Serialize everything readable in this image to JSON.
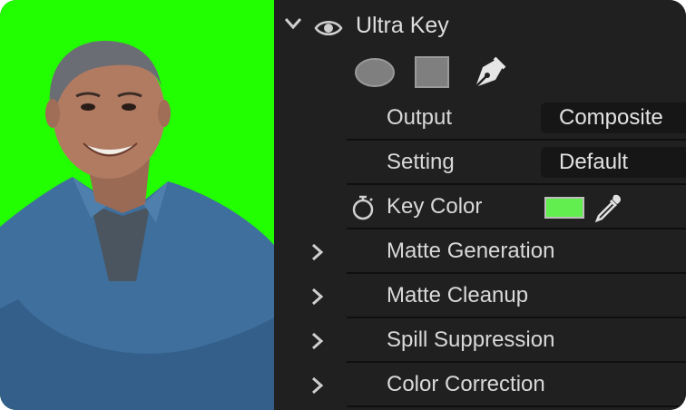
{
  "effect": {
    "title": "Ultra Key",
    "key_color": "#63ee4f"
  },
  "params": {
    "output": {
      "label": "Output",
      "value": "Composite"
    },
    "setting": {
      "label": "Setting",
      "value": "Default"
    },
    "key_color": {
      "label": "Key Color"
    }
  },
  "groups": [
    {
      "label": "Matte Generation"
    },
    {
      "label": "Matte Cleanup"
    },
    {
      "label": "Spill Suppression"
    },
    {
      "label": "Color Correction"
    }
  ],
  "colors": {
    "greenscreen": "#22ff00",
    "panel_bg": "#202020",
    "dropdown_bg": "#161616"
  },
  "icons": [
    "chevron-down-icon",
    "eye-icon",
    "ellipse-mask-icon",
    "rectangle-mask-icon",
    "pen-mask-icon",
    "stopwatch-icon",
    "eyedropper-icon",
    "chevron-right-icon"
  ]
}
